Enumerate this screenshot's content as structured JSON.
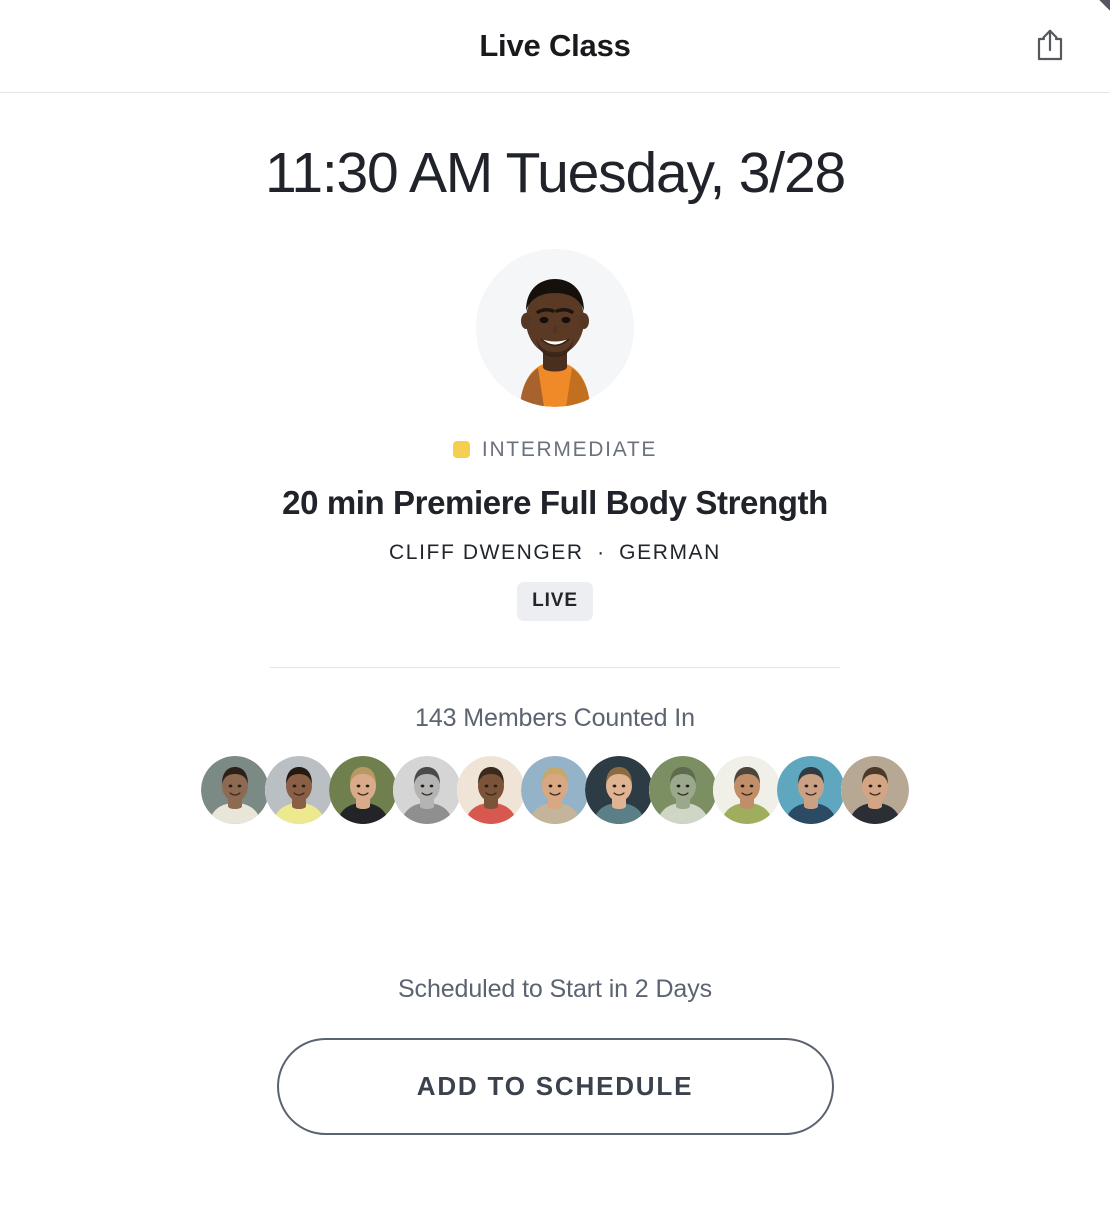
{
  "header": {
    "title": "Live Class",
    "share_icon": "share-icon"
  },
  "class": {
    "datetime": "11:30 AM Tuesday, 3/28",
    "difficulty": "INTERMEDIATE",
    "difficulty_color": "#F6CE51",
    "title": "20 min Premiere Full Body Strength",
    "instructor": "CLIFF DWENGER",
    "separator": "·",
    "language": "GERMAN",
    "live_badge": "LIVE",
    "instructor_avatar_alt": "instructor-portrait"
  },
  "members": {
    "count_text": "143 Members Counted In",
    "count": 143,
    "avatars": [
      {
        "alt": "member-avatar-1",
        "bg": "#7c8a86",
        "skin": "#8d6a52",
        "hair": "#2b2118",
        "shirt": "#e8e6d8"
      },
      {
        "alt": "member-avatar-2",
        "bg": "#b9bfc2",
        "skin": "#8a5f45",
        "hair": "#241a14",
        "shirt": "#ece98f"
      },
      {
        "alt": "member-avatar-3",
        "bg": "#6f7f4d",
        "skin": "#d9ab8a",
        "hair": "#b79a62",
        "shirt": "#232428"
      },
      {
        "alt": "member-avatar-4",
        "bg": "#d5d5d5",
        "skin": "#b4b4b4",
        "hair": "#4a4a4a",
        "shirt": "#8f8f8f"
      },
      {
        "alt": "member-avatar-5",
        "bg": "#efe4d6",
        "skin": "#7b5339",
        "hair": "#3a2a1e",
        "shirt": "#d6584f"
      },
      {
        "alt": "member-avatar-6",
        "bg": "#94b3c9",
        "skin": "#d7a882",
        "hair": "#c7a86b",
        "shirt": "#c4b49a"
      },
      {
        "alt": "member-avatar-7",
        "bg": "#2d3b44",
        "skin": "#e0b393",
        "hair": "#8a6b43",
        "shirt": "#5a7f86"
      },
      {
        "alt": "member-avatar-8",
        "bg": "#7b8f62",
        "skin": "#9aa88c",
        "hair": "#5e6b4f",
        "shirt": "#cfd6c6"
      },
      {
        "alt": "member-avatar-9",
        "bg": "#f0efe8",
        "skin": "#c08f6a",
        "hair": "#4b4639",
        "shirt": "#9fae5c"
      },
      {
        "alt": "member-avatar-10",
        "bg": "#5fa7be",
        "skin": "#caa184",
        "hair": "#2f3a42",
        "shirt": "#2b4a63"
      },
      {
        "alt": "member-avatar-11",
        "bg": "#b6a893",
        "skin": "#d3a584",
        "hair": "#4a3a2c",
        "shirt": "#2b2f35"
      }
    ]
  },
  "footer": {
    "schedule_note": "Scheduled to Start in 2 Days",
    "cta_label": "ADD TO SCHEDULE"
  }
}
